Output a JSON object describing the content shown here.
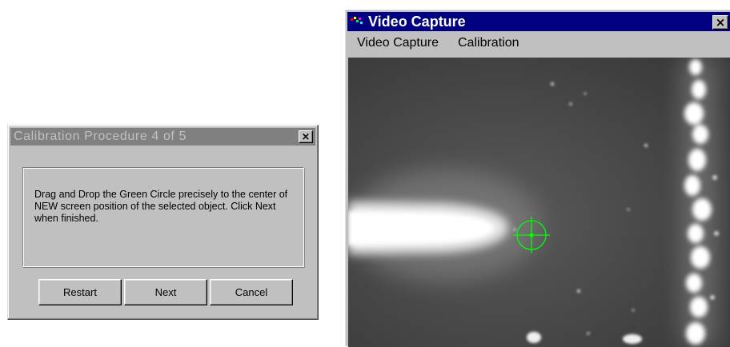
{
  "calibration_dialog": {
    "title": "Calibration Procedure 4 of 5",
    "close_glyph": "×",
    "message": "Drag and Drop the Green Circle precisely to the center of NEW screen position of the selected object. Click Next when finished.",
    "buttons": {
      "restart": "Restart",
      "next": "Next",
      "cancel": "Cancel"
    }
  },
  "video_window": {
    "title": "Video Capture",
    "close_glyph": "×",
    "icon": "app-video-icon",
    "menu": [
      "Video Capture",
      "Calibration"
    ],
    "target_marker": "green-crosshair-circle",
    "marker_color": "#00ff00",
    "titlebar_color": "#000080"
  }
}
